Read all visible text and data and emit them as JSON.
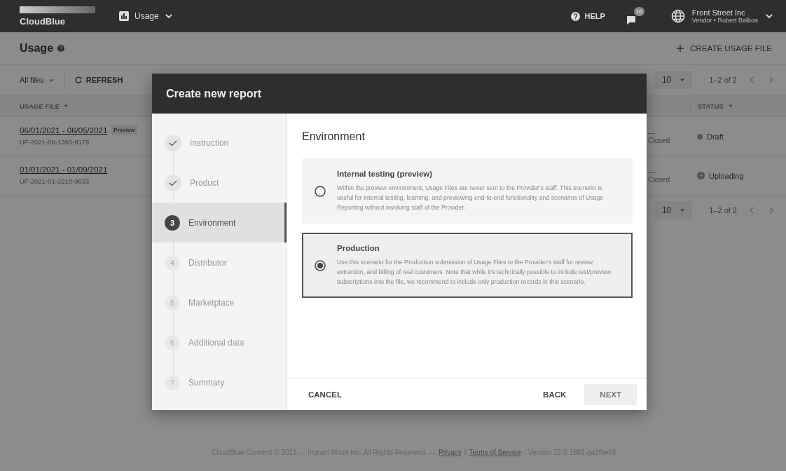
{
  "topbar": {
    "logo": "CloudBlue",
    "module": "Usage",
    "help": "HELP",
    "notifications": "16",
    "account": {
      "name": "Front Street Inc",
      "role": "Vendor • Robert Balboa"
    }
  },
  "page": {
    "title": "Usage",
    "create": "CREATE USAGE FILE"
  },
  "toolbar": {
    "filter": "All files",
    "refresh": "REFRESH",
    "per_page": "10",
    "range": "1–2 of 2"
  },
  "table": {
    "columns": [
      "USAGE FILE",
      "STATUS"
    ],
    "rows": [
      {
        "period": "06/01/2021 - 06/05/2021",
        "tag": "Preview",
        "id": "UF-2021-06-1393-9179",
        "dash": "—",
        "closed": "Closed",
        "status": "Draft",
        "kind": "dot"
      },
      {
        "period": "01/01/2021 - 01/09/2021",
        "id": "UF-2021-01-3210-9633",
        "dash": "—",
        "closed": "Closed",
        "status": "Uploading",
        "kind": "clock"
      }
    ]
  },
  "pagination": {
    "per_page": "10",
    "range": "1–2 of 2"
  },
  "footer": {
    "copyright": "CloudBlue Connect © 2021 — Ingram Micro Inc. All Rights Reserved. —",
    "privacy": "Privacy",
    "sep": "|",
    "terms": "Terms of Service",
    "version": "- Version 22.0.1881-ga3fbe66"
  },
  "dialog": {
    "title": "Create new report",
    "steps": [
      {
        "label": "Instruction",
        "done": true,
        "selected": false
      },
      {
        "label": "Product",
        "done": true,
        "selected": false
      },
      {
        "label": "Environment",
        "number": "3",
        "done": false,
        "selected": true
      },
      {
        "label": "Distributor",
        "number": "4",
        "done": false,
        "selected": false
      },
      {
        "label": "Marketplace",
        "number": "5",
        "done": false,
        "selected": false
      },
      {
        "label": "Additional data",
        "number": "6",
        "done": false,
        "selected": false
      },
      {
        "label": "Summary",
        "number": "7",
        "done": false,
        "selected": false
      }
    ],
    "heading": "Environment",
    "options": [
      {
        "title": "Internal testing (preview)",
        "text": "Within the preview environment, Usage Files are never sent to the Provider's staff. This scenario is useful for internal testing, learning, and previewing end-to-end functionality and scenarios of Usage Reporting without involving staff of the Provider.",
        "selected": false
      },
      {
        "title": "Production",
        "text": "Use this scenario for the Production submission of Usage Files to the Provider's staff for review, extraction, and billing of real customers. Note that while it's technically possible to include test/preview subscriptions into the file, we recommend to include only production records in this scenario.",
        "selected": true
      }
    ],
    "cancel": "CANCEL",
    "back": "BACK",
    "next": "NEXT"
  }
}
